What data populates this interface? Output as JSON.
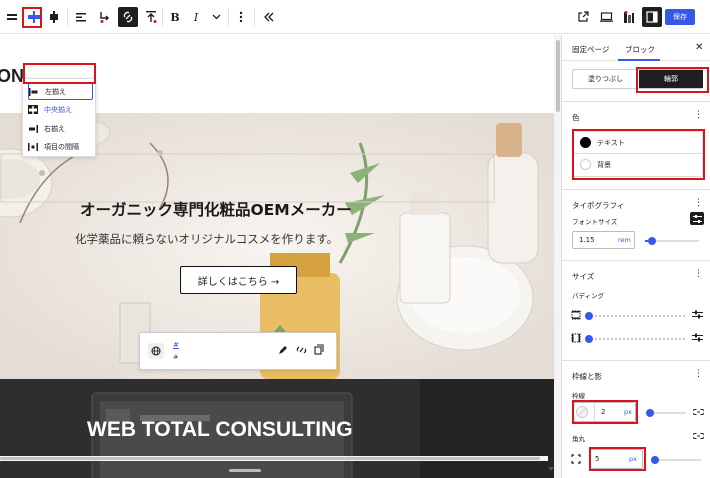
{
  "toolbar": {
    "save_label": "保存"
  },
  "align_menu": {
    "items": [
      {
        "label": "左揃え"
      },
      {
        "label": "中央揃え"
      },
      {
        "label": "右揃え"
      },
      {
        "label": "項目の間隔"
      }
    ]
  },
  "canvas": {
    "partial_heading": "ON",
    "hero_title": "オーガニック専門化粧品OEMメーカー",
    "hero_subtitle": "化学薬品に頼らないオリジナルコスメを作ります。",
    "hero_button": "詳しくはこちら →",
    "link_text": "#",
    "link_sub": "#",
    "banner_title": "WEB TOTAL CONSULTING"
  },
  "sidebar": {
    "tabs": [
      {
        "label": "固定ページ"
      },
      {
        "label": "ブロック"
      }
    ],
    "style_tabs": {
      "fill_label": "塗りつぶし",
      "outline_label": "輪郭"
    },
    "color": {
      "title": "色",
      "text_label": "テキスト",
      "bg_label": "背景"
    },
    "typography": {
      "title": "タイポグラフィ",
      "font_size_label": "フォントサイズ",
      "font_size_value": "1.15",
      "font_size_unit": "rem",
      "font_size_level": 0.05
    },
    "size": {
      "title": "サイズ",
      "padding_label": "パディング"
    },
    "border": {
      "title": "枠線と影",
      "border_label": "枠線",
      "border_value": "2",
      "border_unit": "px",
      "radius_label": "角丸",
      "radius_value": "5",
      "radius_unit": "px"
    }
  },
  "colors": {
    "accent": "#3858e9",
    "highlight": "#d9141e"
  }
}
